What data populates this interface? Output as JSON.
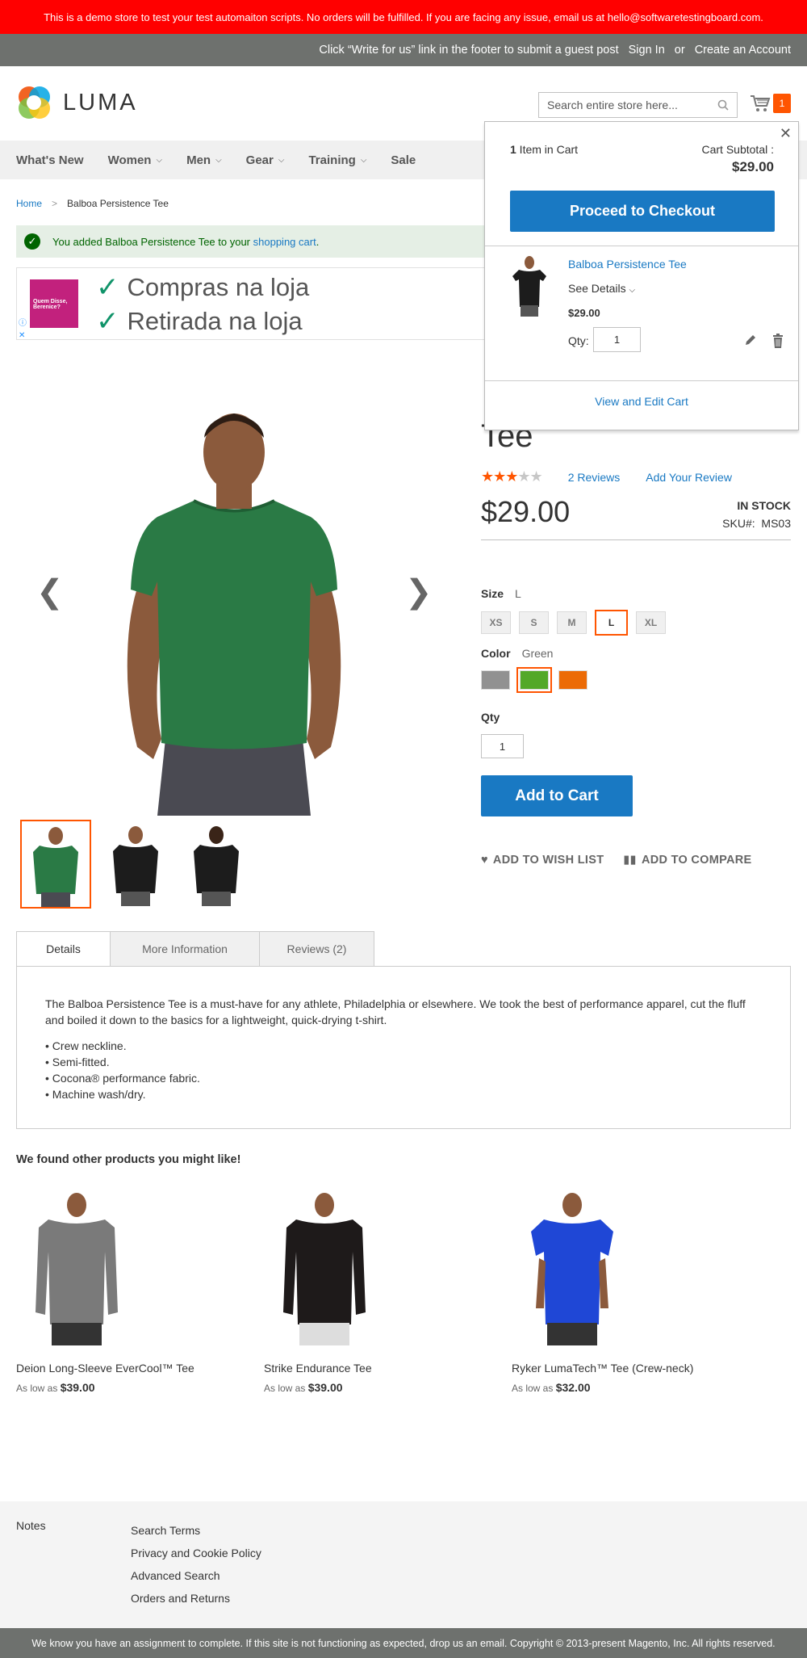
{
  "demo_notice": "This is a demo store to test your test automaiton scripts. No orders will be fulfilled. If you are facing any issue, email us at hello@softwaretestingboard.com.",
  "header": {
    "write_for_us": "Click “Write for us” link in the footer to submit a guest post",
    "sign_in": "Sign In",
    "or": "or",
    "create_account": "Create an Account"
  },
  "logo": {
    "text": "LUMA"
  },
  "search": {
    "placeholder": "Search entire store here..."
  },
  "cart": {
    "count": "1"
  },
  "nav": {
    "items": [
      {
        "label": "What's New",
        "has_dropdown": false
      },
      {
        "label": "Women",
        "has_dropdown": true
      },
      {
        "label": "Men",
        "has_dropdown": true
      },
      {
        "label": "Gear",
        "has_dropdown": true
      },
      {
        "label": "Training",
        "has_dropdown": true
      },
      {
        "label": "Sale",
        "has_dropdown": false
      }
    ]
  },
  "breadcrumb": {
    "home": "Home",
    "separator": ">",
    "current": "Balboa Persistence Tee"
  },
  "message": {
    "prefix": "You added Balboa Persistence Tee to your ",
    "link": "shopping cart",
    "suffix": "."
  },
  "ad": {
    "box_text": "Quem Disse, Berenice?",
    "line1": "Compras na loja",
    "line2": "Retirada na loja"
  },
  "product": {
    "title_visible": "Tee",
    "rating": 3,
    "rating_max": 5,
    "reviews_link": "2  Reviews",
    "add_review": "Add Your Review",
    "price": "$29.00",
    "stock": "IN STOCK",
    "sku_label": "SKU#:",
    "sku": "MS03",
    "size_label": "Size",
    "size_selected": "L",
    "sizes": [
      "XS",
      "S",
      "M",
      "L",
      "XL"
    ],
    "color_label": "Color",
    "color_selected": "Green",
    "colors": [
      "#919191",
      "#53a828",
      "#ec6b06"
    ],
    "qty_label": "Qty",
    "qty": "1",
    "add_to_cart": "Add to Cart",
    "wishlist": "ADD TO WISH LIST",
    "compare": "ADD TO COMPARE"
  },
  "tabs": [
    {
      "label": "Details"
    },
    {
      "label": "More Information"
    },
    {
      "label": "Reviews (2)"
    }
  ],
  "details": {
    "description": "The Balboa Persistence Tee is a must-have for any athlete, Philadelphia or elsewhere. We took the best of performance apparel, cut the fluff and boiled it down to the basics for a lightweight, quick-drying t-shirt.",
    "bullets": [
      "• Crew neckline.",
      "• Semi-fitted.",
      "• Cocona® performance fabric.",
      "• Machine wash/dry."
    ]
  },
  "related": {
    "title": "We found other products you might like!",
    "items": [
      {
        "name": "Deion Long-Sleeve EverCool™ Tee",
        "price_prefix": "As low as",
        "price": "$39.00"
      },
      {
        "name": "Strike Endurance Tee",
        "price_prefix": "As low as",
        "price": "$39.00"
      },
      {
        "name": "Ryker LumaTech™ Tee (Crew-neck)",
        "price_prefix": "As low as",
        "price": "$32.00"
      }
    ]
  },
  "footer": {
    "notes": "Notes",
    "links": [
      "Search Terms",
      "Privacy and Cookie Policy",
      "Advanced Search",
      "Orders and Returns"
    ],
    "copyright": "We know you have an assignment to complete. If this site is not functioning as expected, drop us an email. Copyright © 2013-present Magento, Inc. All rights reserved."
  },
  "minicart": {
    "count_num": "1",
    "count_text": " Item in Cart",
    "subtotal_label": "Cart Subtotal :",
    "subtotal": "$29.00",
    "checkout": "Proceed to Checkout",
    "item_name": "Balboa Persistence Tee",
    "see_details": "See Details",
    "item_price": "$29.00",
    "qty_label": "Qty:",
    "qty": "1",
    "view_edit": "View and Edit Cart"
  },
  "colors": {
    "accent": "#1979c3",
    "orange": "#ff5501",
    "demo_red": "#ff0000"
  }
}
